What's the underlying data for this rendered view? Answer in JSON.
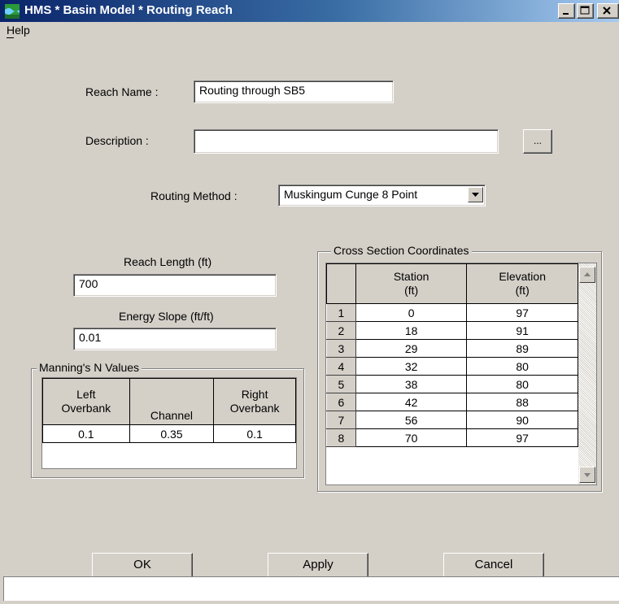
{
  "window": {
    "title": "HMS * Basin Model * Routing Reach",
    "title_bar_color": "#0a246a"
  },
  "menu": {
    "help": "Help"
  },
  "reach_name": {
    "label": "Reach Name :",
    "value": "Routing through SB5"
  },
  "description": {
    "label": "Description :",
    "value": "",
    "browse_label": "..."
  },
  "routing_method": {
    "label": "Routing Method :",
    "value": "Muskingum Cunge 8 Point"
  },
  "reach_length": {
    "label": "Reach Length (ft)",
    "value": "700"
  },
  "energy_slope": {
    "label": "Energy Slope (ft/ft)",
    "value": "0.01"
  },
  "mannings": {
    "title": "Manning's N Values",
    "headers": [
      [
        "Left",
        "Overbank"
      ],
      [
        "Channel"
      ],
      [
        "Right",
        "Overbank"
      ]
    ],
    "values": [
      "0.1",
      "0.35",
      "0.1"
    ]
  },
  "cross_section": {
    "title": "Cross Section Coordinates",
    "headers": [
      [
        "Station",
        "(ft)"
      ],
      [
        "Elevation",
        "(ft)"
      ]
    ],
    "rows": [
      {
        "n": "1",
        "station": "0",
        "elevation": "97"
      },
      {
        "n": "2",
        "station": "18",
        "elevation": "91"
      },
      {
        "n": "3",
        "station": "29",
        "elevation": "89"
      },
      {
        "n": "4",
        "station": "32",
        "elevation": "80"
      },
      {
        "n": "5",
        "station": "38",
        "elevation": "80"
      },
      {
        "n": "6",
        "station": "42",
        "elevation": "88"
      },
      {
        "n": "7",
        "station": "56",
        "elevation": "90"
      },
      {
        "n": "8",
        "station": "70",
        "elevation": "97"
      }
    ]
  },
  "buttons": {
    "ok": "OK",
    "apply": "Apply",
    "cancel": "Cancel"
  },
  "status": {
    "text": ""
  }
}
